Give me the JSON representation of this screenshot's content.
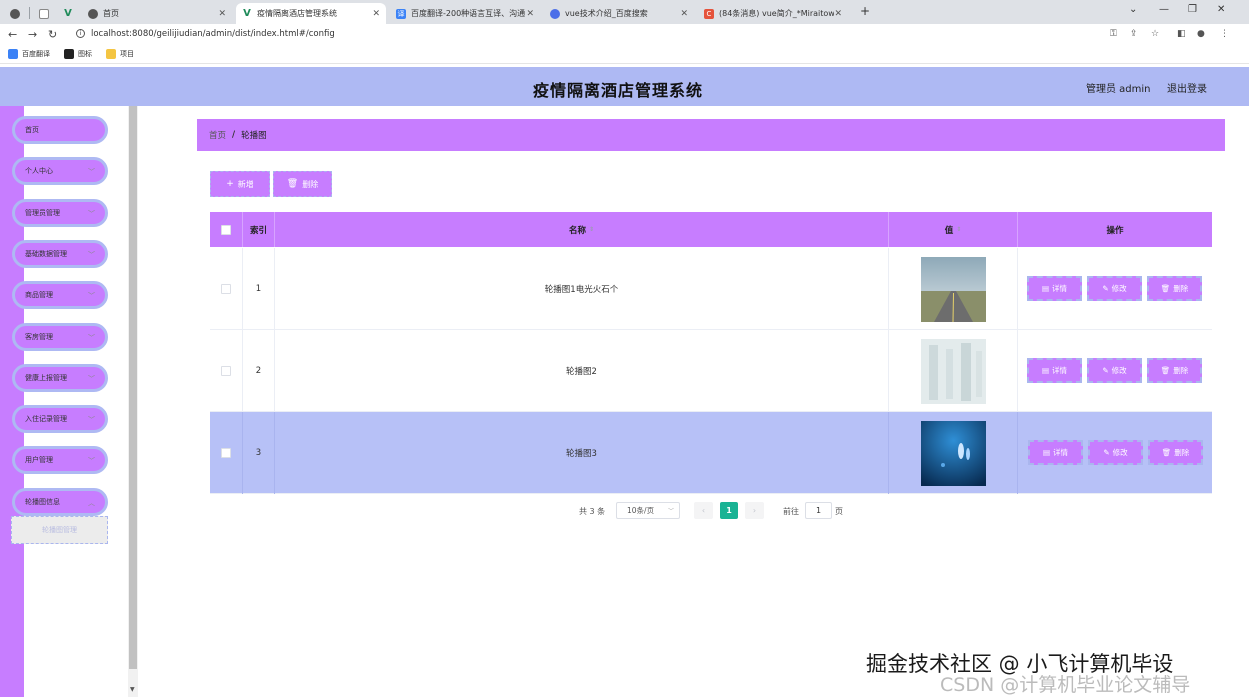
{
  "browser": {
    "tabs": [
      {
        "label": "",
        "icon": "generic-page-icon",
        "active": false
      },
      {
        "label": "首页",
        "icon": "vue-favicon-icon",
        "active": false
      },
      {
        "label": "疫情隔离酒店管理系统",
        "icon": "vue-favicon-icon",
        "active": true
      },
      {
        "label": "百度翻译-200种语言互译、沟通",
        "icon": "baidu-translate-icon",
        "active": false
      },
      {
        "label": "vue技术介绍_百度搜索",
        "icon": "baidu-paw-icon",
        "active": false
      },
      {
        "label": "(84条消息) vue简介_*Miraitow",
        "icon": "csdn-icon",
        "active": false
      }
    ],
    "url": "localhost:8080/geilijiudian/admin/dist/index.html#/config",
    "bookmarks": [
      "百度翻译",
      "图标",
      "项目"
    ]
  },
  "header": {
    "title": "疫情隔离酒店管理系统",
    "admin_label": "管理员 admin",
    "logout_label": "退出登录"
  },
  "sidebar": {
    "items": [
      {
        "label": "首页",
        "has_chevron": false
      },
      {
        "label": "个人中心",
        "has_chevron": true
      },
      {
        "label": "管理员管理",
        "has_chevron": true
      },
      {
        "label": "基础数据管理",
        "has_chevron": true
      },
      {
        "label": "商品管理",
        "has_chevron": true
      },
      {
        "label": "客房管理",
        "has_chevron": true
      },
      {
        "label": "健康上报管理",
        "has_chevron": true
      },
      {
        "label": "入住记录管理",
        "has_chevron": true
      },
      {
        "label": "用户管理",
        "has_chevron": true
      },
      {
        "label": "轮播图信息",
        "has_chevron": true
      }
    ],
    "active_submenu": "轮播图管理"
  },
  "breadcrumb": {
    "home": "首页",
    "separator": "/",
    "current": "轮播图"
  },
  "actions": {
    "add_label": "新增",
    "delete_label": "删除"
  },
  "table": {
    "columns": {
      "index": "索引",
      "name": "名称",
      "value": "值",
      "operation": "操作"
    },
    "rows": [
      {
        "index": "1",
        "name": "轮播图1电光火石个",
        "image": "road-landscape"
      },
      {
        "index": "2",
        "name": "轮播图2",
        "image": "frosted-glass"
      },
      {
        "index": "3",
        "name": "轮播图3",
        "image": "underwater-blue"
      }
    ],
    "row_buttons": {
      "detail": "详情",
      "edit": "修改",
      "delete": "删除"
    },
    "highlighted_row": 3
  },
  "pagination": {
    "total_text": "共 3 条",
    "page_size": "10条/页",
    "current_page": "1",
    "goto_label": "前往",
    "goto_value": "1",
    "page_unit": "页"
  },
  "watermark": {
    "line1": "掘金技术社区 @ 小飞计算机毕设",
    "line2": "CSDN @计算机毕业论文辅导"
  },
  "colors": {
    "header_bg": "#aeb9f3",
    "accent_purple": "#c77dff",
    "highlight_row": "#b7c1f7",
    "pager_active": "#19b394"
  }
}
